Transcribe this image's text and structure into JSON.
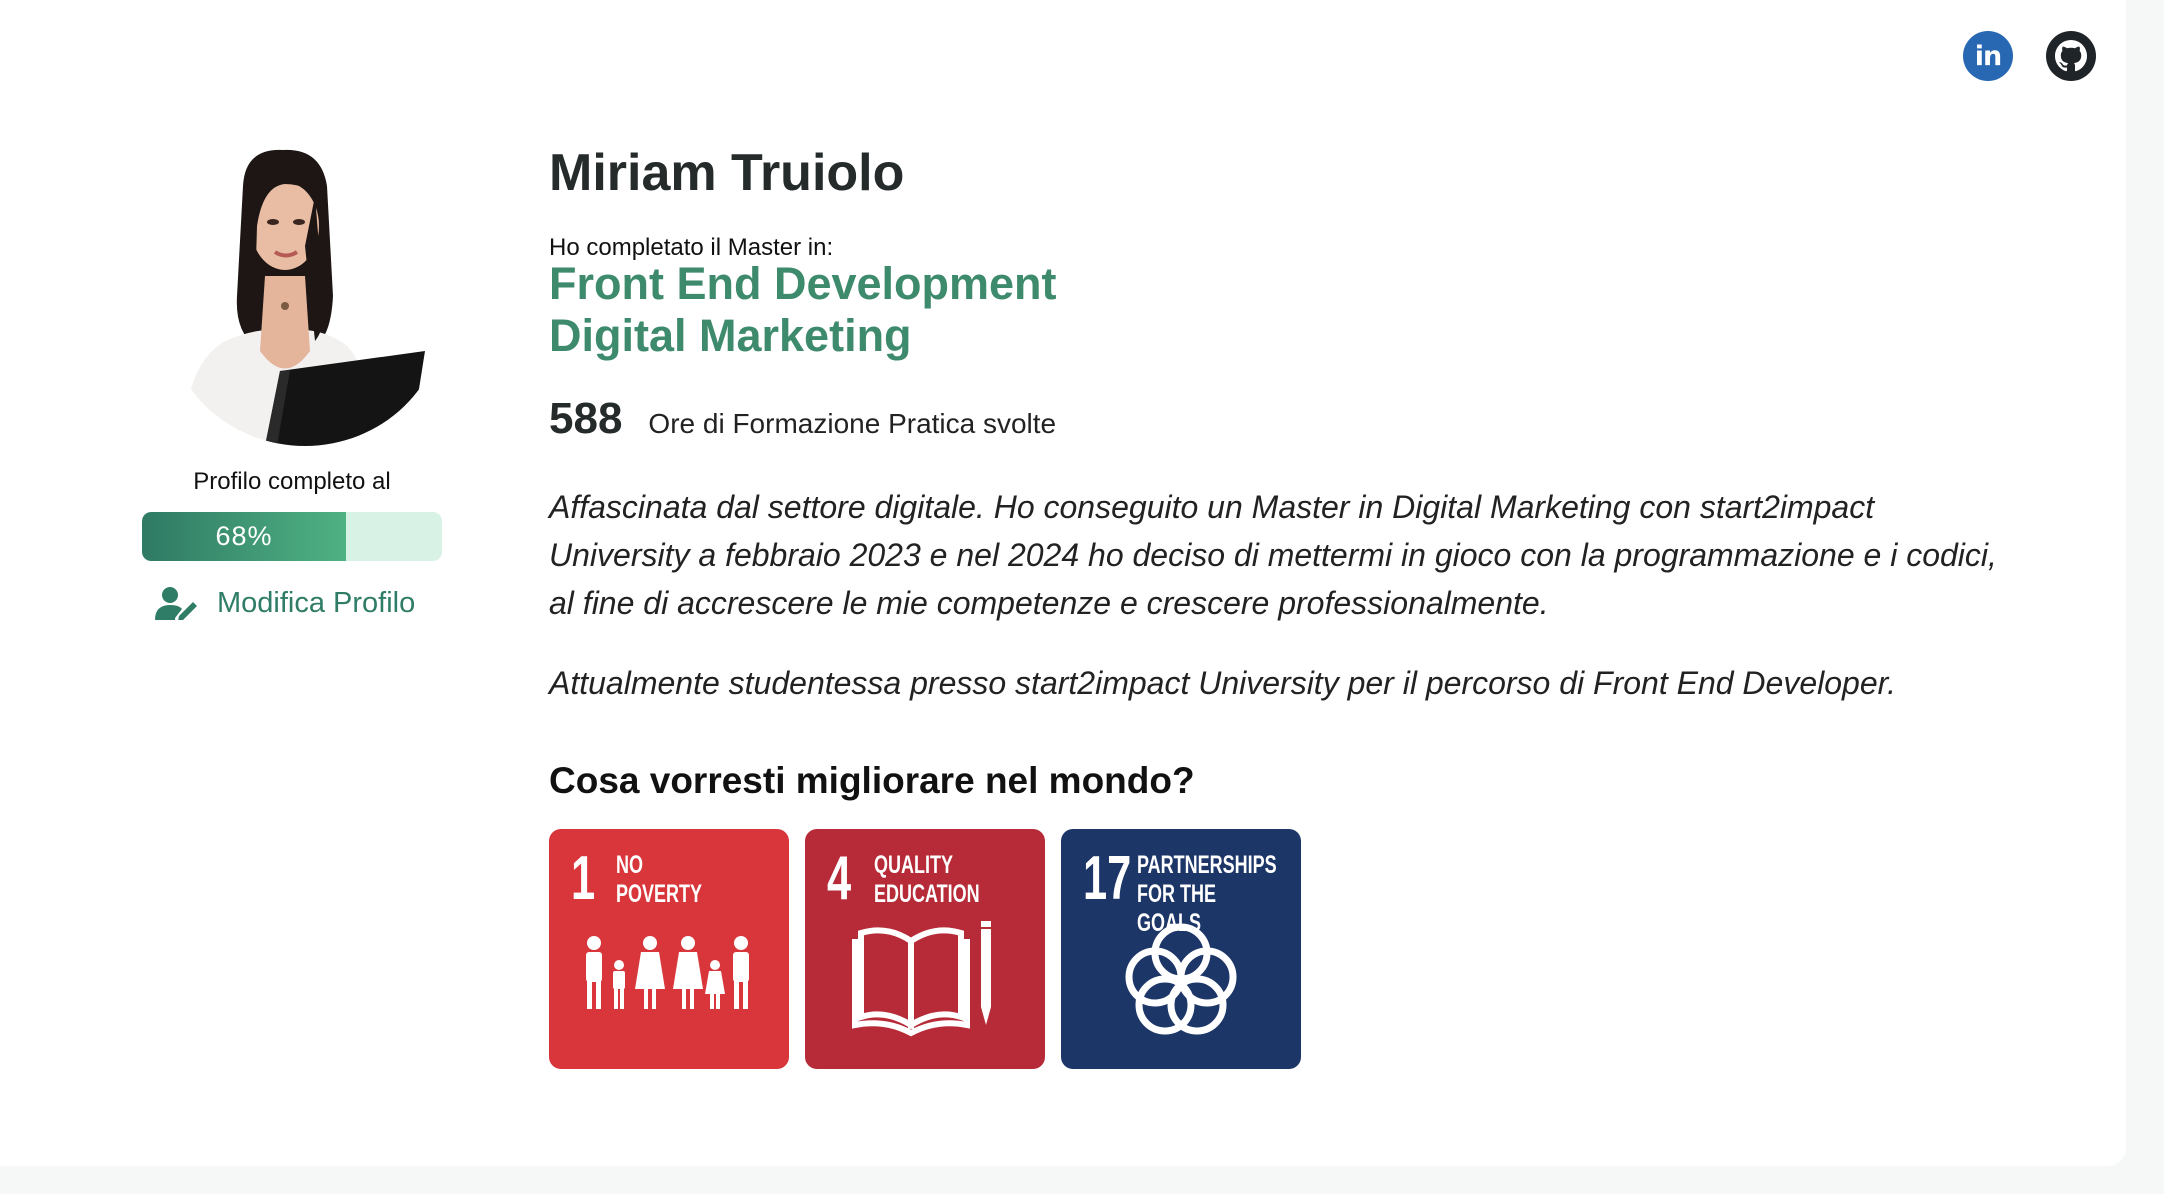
{
  "profile": {
    "name": "Miriam Truiolo",
    "progress_label": "Profilo completo al",
    "progress_value": 0.68,
    "progress_text": "68%",
    "edit_label": "Modifica Profilo",
    "master_lead": "Ho completato il Master in:",
    "masters": [
      "Front End Development",
      "Digital Marketing"
    ],
    "hours_value": "588",
    "hours_label": "Ore di Formazione Pratica svolte",
    "bio": [
      "Affascinata dal settore digitale. Ho conseguito un Master in Digital Marketing con start2impact University a febbraio 2023 e nel 2024 ho deciso di mettermi in gioco con la programmazione e i codici, al fine di accrescere le mie competenze e crescere professionalmente.",
      "Attualmente studentessa presso start2impact University per il percorso di Front End Developer."
    ]
  },
  "social": {
    "linkedin_glyph": "in",
    "icons": [
      "linkedin-icon",
      "github-icon"
    ]
  },
  "goals_section": {
    "question": "Cosa vorresti migliorare nel mondo?",
    "goals": [
      {
        "number": "1",
        "title_line1": "NO",
        "title_line2": "POVERTY",
        "color": "#d9363b",
        "icon": "family-icon"
      },
      {
        "number": "4",
        "title_line1": "QUALITY",
        "title_line2": "EDUCATION",
        "color": "#b62b37",
        "icon": "book-pencil-icon"
      },
      {
        "number": "17",
        "title_line1": "PARTNERSHIPS",
        "title_line2": "FOR THE GOALS",
        "color": "#1d3668",
        "icon": "rings-icon"
      }
    ]
  },
  "colors": {
    "accent": "#3e8a6d",
    "progress_track": "#d8f2e6",
    "linkedin": "#2867b2",
    "github": "#1f2428"
  }
}
